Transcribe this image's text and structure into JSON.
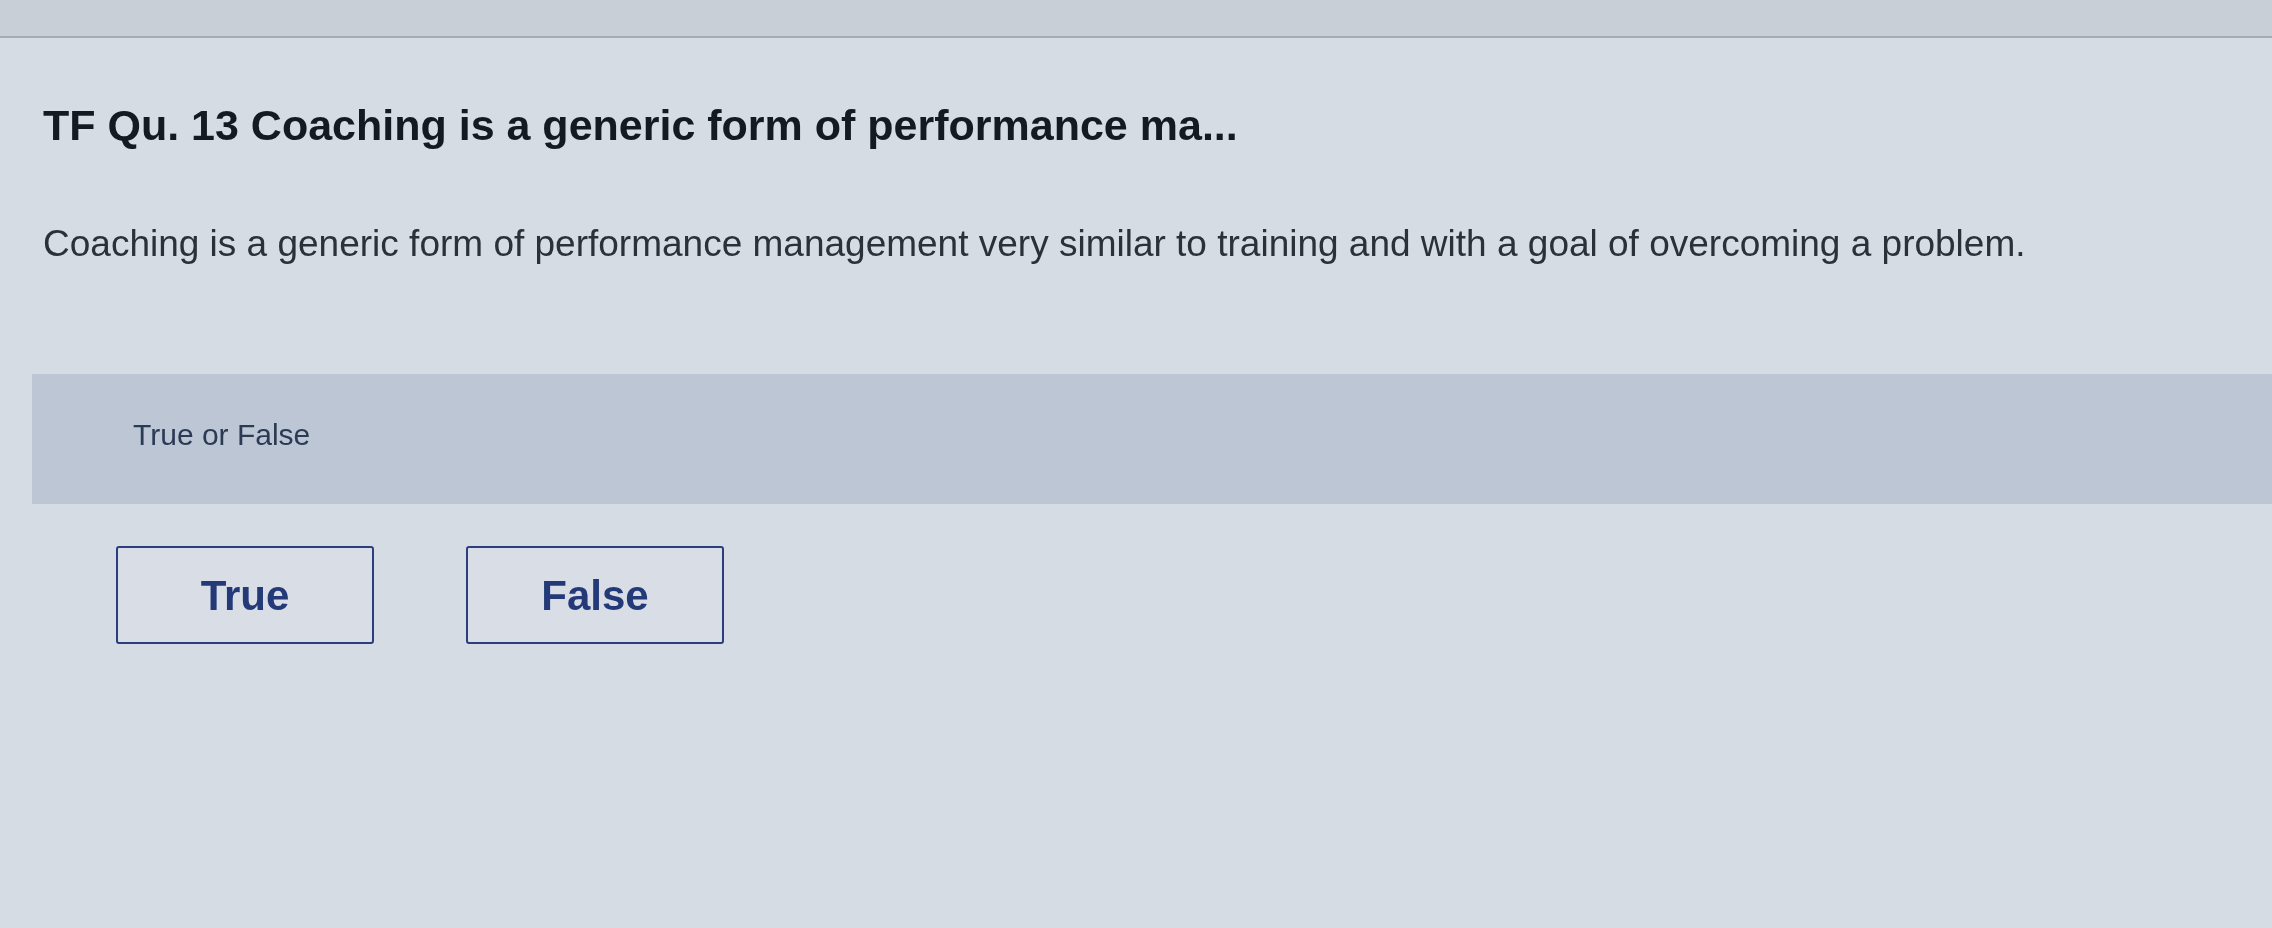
{
  "question": {
    "title": "TF Qu. 13 Coaching is a generic form of performance ma...",
    "text": "Coaching is a generic form of performance management very similar to training and with a goal of overcoming a problem."
  },
  "answer_panel": {
    "prompt": "True or False",
    "options": [
      {
        "label": "True"
      },
      {
        "label": "False"
      }
    ]
  }
}
